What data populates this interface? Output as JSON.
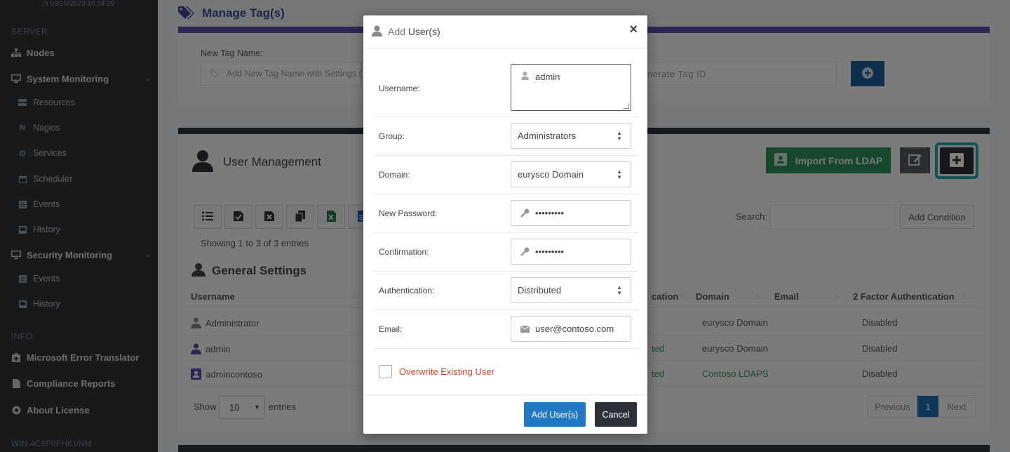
{
  "sidebar": {
    "timestamp": "03/10/2023 16:34:29",
    "section_server": "SERVER",
    "nodes": "Nodes",
    "system_monitoring": "System Monitoring",
    "system_sub": [
      "Resources",
      "Nagios",
      "Services",
      "Scheduler",
      "Events",
      "History"
    ],
    "security_monitoring": "Security Monitoring",
    "security_sub": [
      "Events",
      "History"
    ],
    "section_info": "INFO",
    "info_items": [
      "Microsoft Error Translator",
      "Compliance Reports",
      "About License"
    ],
    "hostname": "WIN-4C6P0FHKVNM"
  },
  "tags": {
    "title": "Manage Tag(s)",
    "new_tag_label": "New Tag Name:",
    "new_tag_placeholder": "Add New Tag Name with Settings (",
    "tag_id_placeholder": "enerate Tag ID"
  },
  "users": {
    "title": "User Management",
    "import_ldap": "Import From LDAP",
    "search_label": "Search:",
    "add_condition": "Add Condition",
    "entries_info": "Showing 1 to 3 of 3 entries",
    "general_settings": "General Settings",
    "columns": {
      "username": "Username",
      "auth": "cation",
      "domain": "Domain",
      "email": "Email",
      "two_factor": "2 Factor Authentication"
    },
    "rows": [
      {
        "username": "Administrator",
        "auth": "",
        "domain": "eurysco Domain",
        "two_factor": "Disabled"
      },
      {
        "username": "admin",
        "auth": "ted",
        "domain": "eurysco Domain",
        "two_factor": "Disabled"
      },
      {
        "username": "admincontoso",
        "auth": "ted",
        "domain": "Contoso LDAPS",
        "two_factor": "Disabled"
      }
    ],
    "show_label": "Show",
    "show_value": "10",
    "entries_label": "entries",
    "pager": {
      "previous": "Previous",
      "current": "1",
      "next": "Next"
    }
  },
  "modal": {
    "title_prefix": "Add ",
    "title_main": "User(s)",
    "close": "×",
    "username_label": "Username:",
    "username_value": "admin",
    "group_label": "Group:",
    "group_value": "Administrators",
    "domain_label": "Domain:",
    "domain_value": "eurysco Domain",
    "new_password_label": "New Password:",
    "new_password_value": "•••••••••",
    "confirmation_label": "Confirmation:",
    "confirmation_value": "•••••••••",
    "authentication_label": "Authentication:",
    "authentication_value": "Distributed",
    "email_label": "Email:",
    "email_value": "user@contoso.com",
    "overwrite_label": "Overwrite Existing User",
    "add_button": "Add User(s)",
    "cancel_button": "Cancel"
  },
  "colors": {
    "tag_bar": "#5f4fa7",
    "ldap_green": "#2f8f5b",
    "primary_blue": "#1f79c7",
    "highlight_teal": "#1ba8a8",
    "danger_text": "#d0452b"
  }
}
